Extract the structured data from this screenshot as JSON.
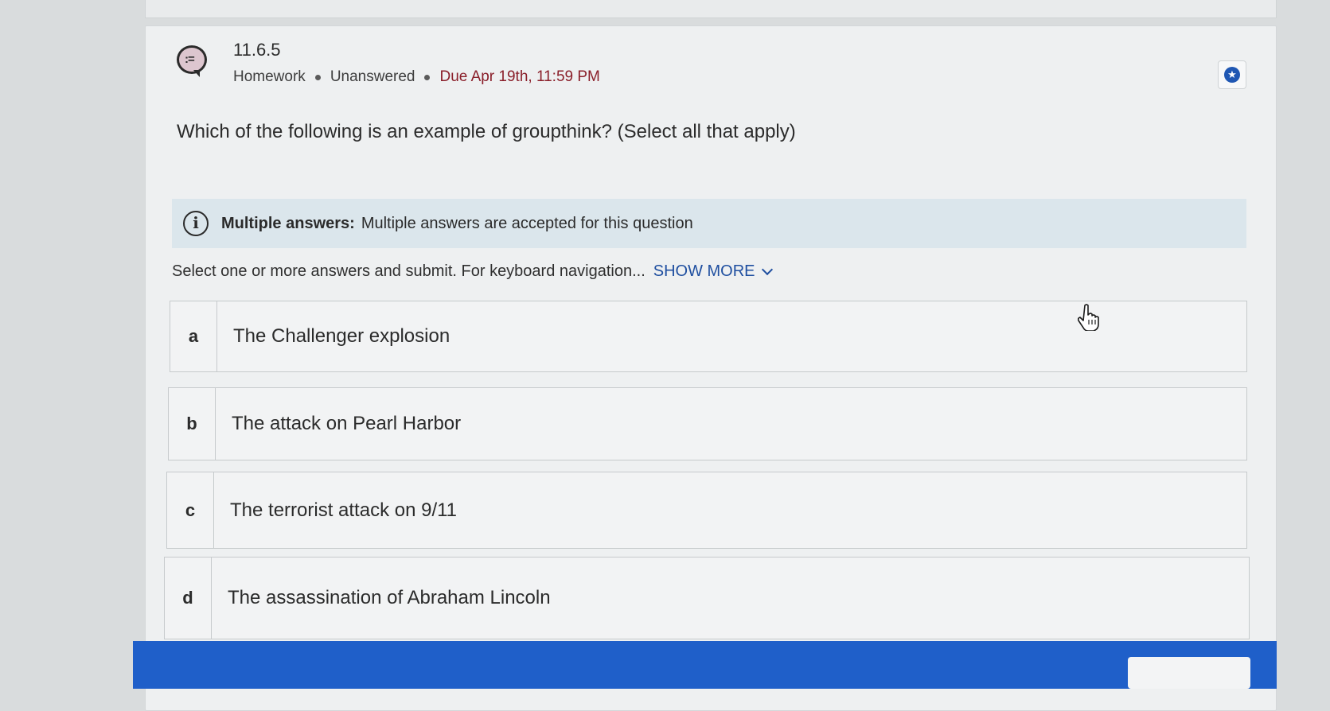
{
  "question": {
    "number": "11.6.5",
    "type": "Homework",
    "status": "Unanswered",
    "due": "Due Apr 19th, 11:59 PM",
    "prompt": "Which of the following is an example of groupthink? (Select all that apply)"
  },
  "info": {
    "label": "Multiple answers:",
    "text": "Multiple answers are accepted for this question"
  },
  "instructions": {
    "text": "Select one or more answers and submit. For keyboard navigation...",
    "show_more": "SHOW MORE"
  },
  "options": [
    {
      "letter": "a",
      "text": "The Challenger explosion"
    },
    {
      "letter": "b",
      "text": "The attack on Pearl Harbor"
    },
    {
      "letter": "c",
      "text": "The terrorist attack on 9/11"
    },
    {
      "letter": "d",
      "text": "The assassination of Abraham Lincoln"
    }
  ],
  "icons": {
    "question_icon": "question-list-icon",
    "bookmark_icon": "star-bookmark-icon",
    "info_icon": "info-icon",
    "cursor": "hand-pointer-icon"
  },
  "colors": {
    "due": "#8a1f2a",
    "link": "#1f4fa0",
    "submit_bar": "#1f5fc9",
    "bookmark": "#1f57b3",
    "info_bg": "#dbe6ec"
  }
}
